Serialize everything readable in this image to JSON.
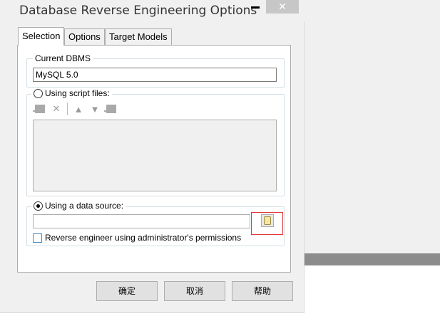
{
  "window": {
    "title": "Database Reverse Engineering Options",
    "close_glyph": "✕"
  },
  "tabs": [
    {
      "label": "Selection",
      "active": true
    },
    {
      "label": "Options",
      "active": false
    },
    {
      "label": "Target Models",
      "active": false
    }
  ],
  "current_dbms": {
    "legend": "Current DBMS",
    "value": "MySQL 5.0"
  },
  "script_files": {
    "label": "Using script files:",
    "selected": false,
    "toolbar_icons": [
      "add-file-icon",
      "delete-icon",
      "move-up-icon",
      "move-down-icon",
      "clear-icon"
    ],
    "items": []
  },
  "data_source": {
    "label": "Using a data source:",
    "selected": true,
    "value": "",
    "browse_icon": "database-icon",
    "admin_checkbox_label": "Reverse engineer using administrator's permissions",
    "admin_checked": false
  },
  "buttons": {
    "ok": "确定",
    "cancel": "取消",
    "help": "帮助"
  },
  "colors": {
    "highlight_box": "#e03a3a",
    "checkbox_border": "#3c8bc7"
  }
}
